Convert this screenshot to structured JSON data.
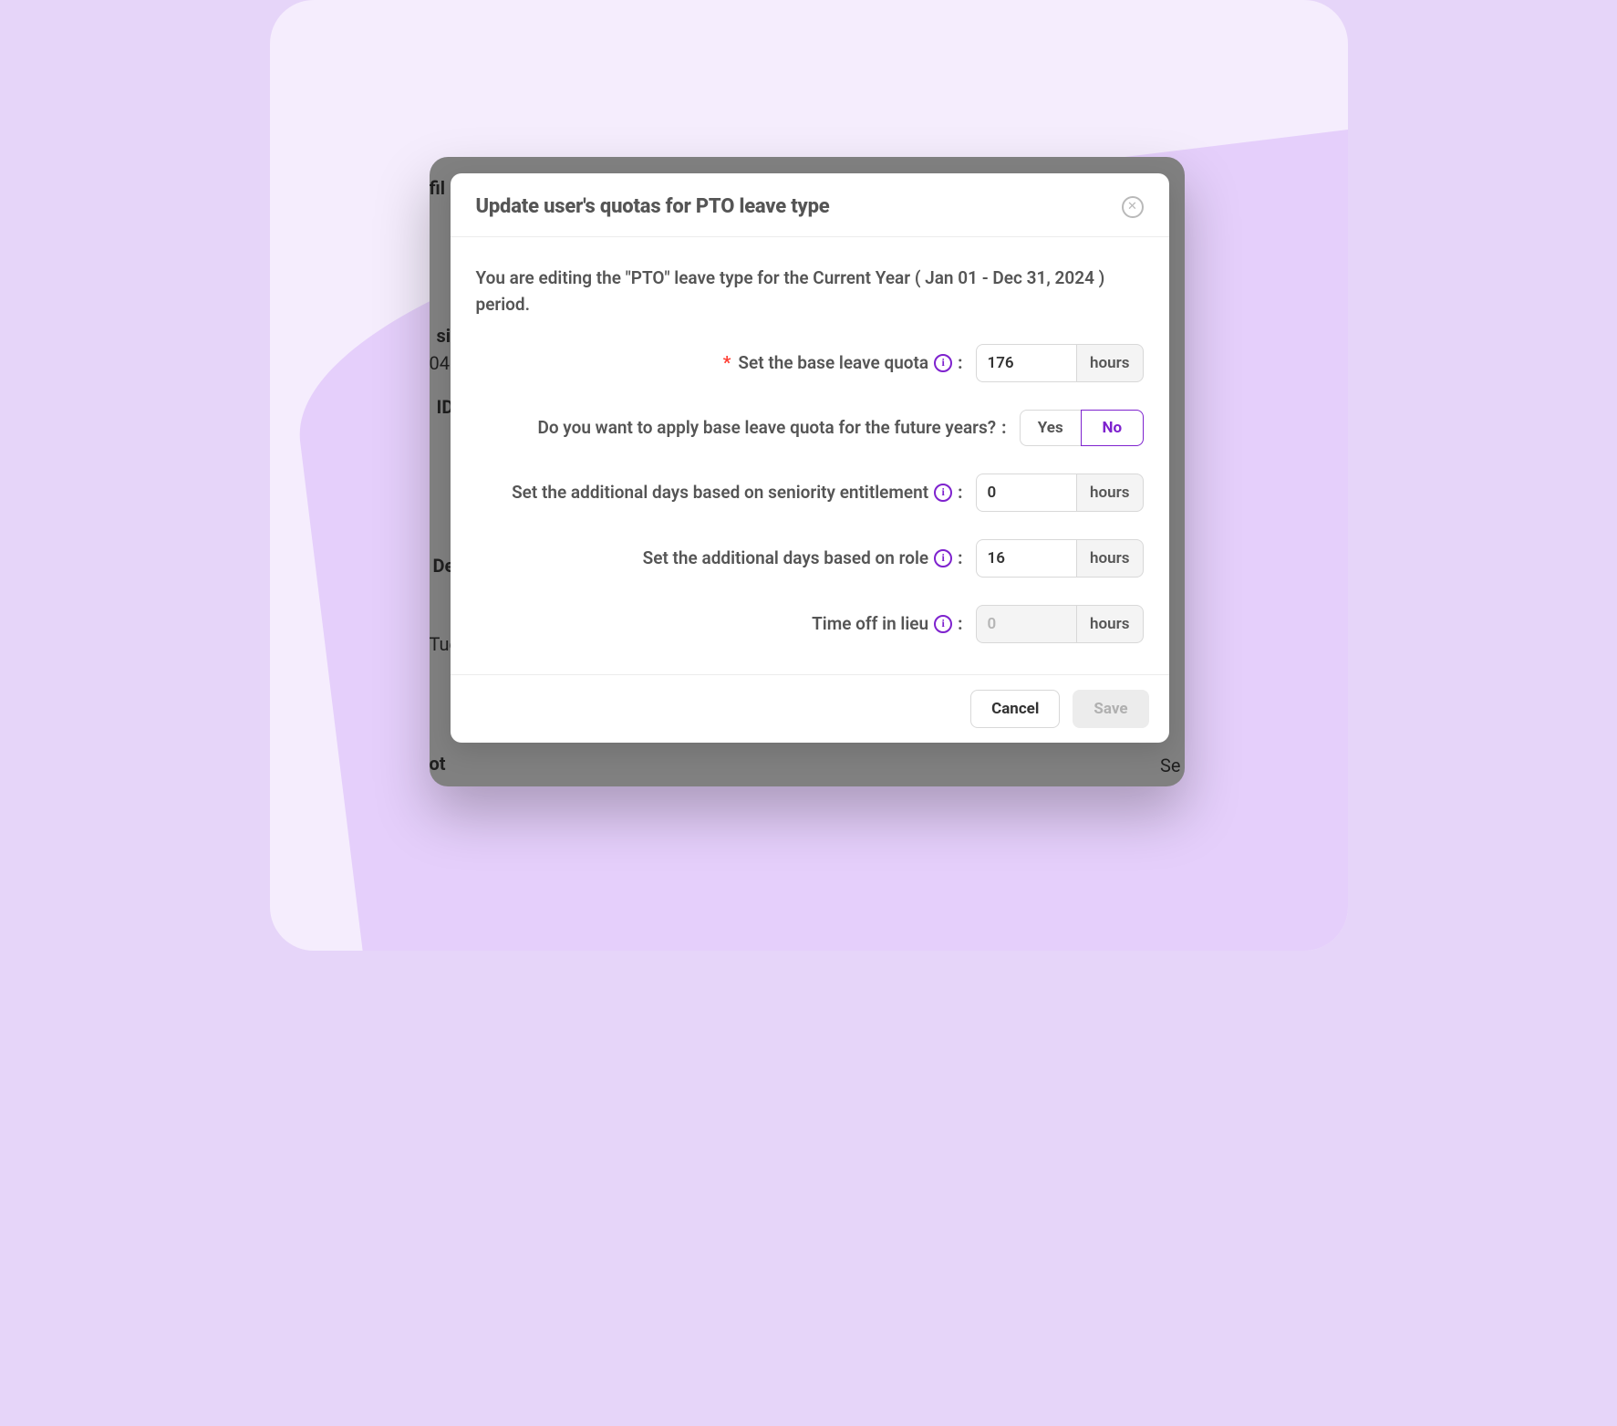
{
  "modal": {
    "title": "Update user's quotas for PTO leave type",
    "intro": "You are editing the \"PTO\" leave type for the Current Year ( Jan 01 - Dec 31, 2024 ) period.",
    "rows": {
      "base_quota": {
        "label": "Set the base leave quota",
        "value": "176",
        "unit": "hours"
      },
      "future_years": {
        "label": "Do you want to apply base leave quota for the future years?",
        "yes": "Yes",
        "no": "No",
        "selected": "No"
      },
      "seniority": {
        "label": "Set the additional days based on seniority entitlement",
        "value": "0",
        "unit": "hours"
      },
      "role": {
        "label": "Set the additional days based on role",
        "value": "16",
        "unit": "hours"
      },
      "toil": {
        "label": "Time off in lieu",
        "placeholder": "0",
        "unit": "hours"
      }
    },
    "footer": {
      "cancel": "Cancel",
      "save": "Save"
    }
  },
  "backdrop": {
    "fil": "fil",
    "si": "si",
    "num": "04",
    "id": "ID",
    "de": "De",
    "tue": "Tue",
    "q": "ot",
    "se": "Se"
  }
}
